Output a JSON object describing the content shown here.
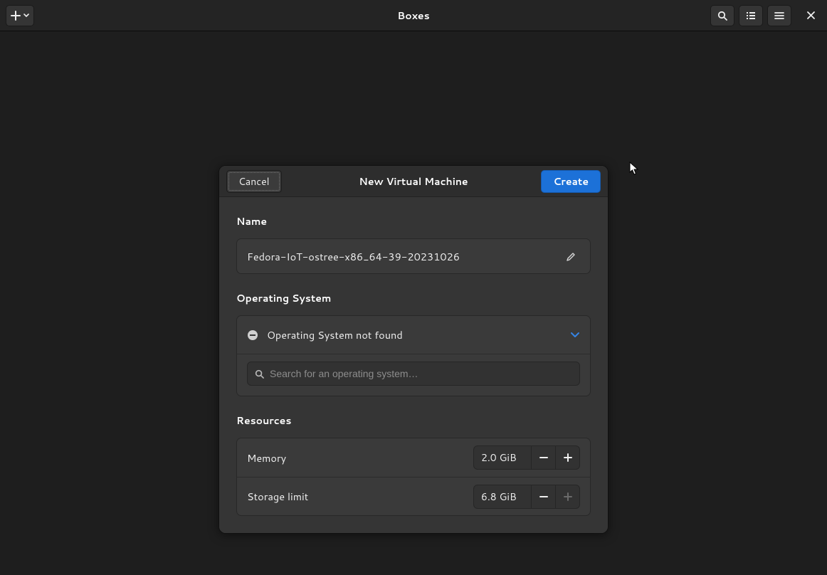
{
  "titlebar": {
    "title": "Boxes"
  },
  "dialog": {
    "title": "New Virtual Machine",
    "cancel_label": "Cancel",
    "create_label": "Create",
    "name_section_label": "Name",
    "name_value": "Fedora-IoT-ostree-x86_64-39-20231026",
    "os_section_label": "Operating System",
    "os_status": "Operating System not found",
    "os_search_placeholder": "Search for an operating system…",
    "resources_section_label": "Resources",
    "memory_label": "Memory",
    "memory_value": "2.0 GiB",
    "storage_label": "Storage limit",
    "storage_value": "6.8 GiB"
  }
}
